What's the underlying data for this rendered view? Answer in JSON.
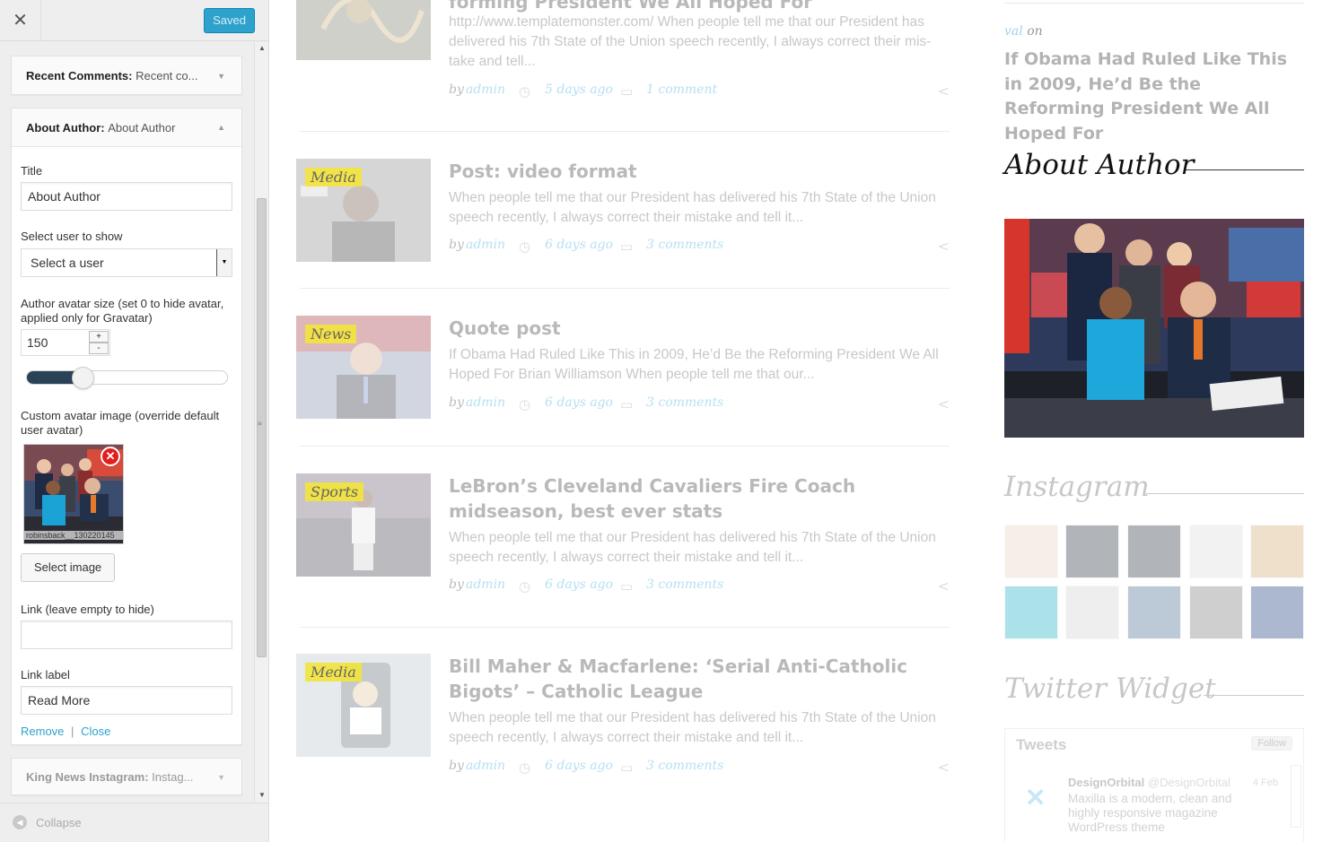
{
  "customizer": {
    "close_icon": "close-icon",
    "saved_label": "Saved",
    "widgets": [
      {
        "name": "Recent Comments:",
        "subtitle": "Recent co..."
      },
      {
        "name": "About Author:",
        "subtitle": "About Author"
      },
      {
        "name": "King News Instagram:",
        "subtitle": "Instag..."
      }
    ],
    "about_author": {
      "title_label": "Title",
      "title_value": "About Author",
      "user_label": "Select user to show",
      "user_selected": "Select a user",
      "avatar_size_label": "Author avatar size (set 0 to hide avatar, applied only for Gravatar)",
      "avatar_size_value": "150",
      "avatar_size_slider_fraction": 0.28,
      "custom_avatar_label": "Custom avatar image (override default user avatar)",
      "avatar_filename": "robinsback__130220145",
      "select_image_label": "Select image",
      "link_label": "Link (leave empty to hide)",
      "link_value": "",
      "link_text_label": "Link label",
      "link_text_value": "Read More",
      "remove_label": "Remove",
      "sep": "|",
      "close_label": "Close"
    },
    "collapse_label": "Collapse",
    "colors": {
      "accent": "#2ea2cc",
      "slider_fill": "#294257",
      "remove_badge": "#e02020"
    }
  },
  "preview": {
    "posts": [
      {
        "title": "forming President We All Hoped For",
        "category": "",
        "excerpt": "http://www.templatemonster.com/ When people tell me that our President has delivered his 7th State of the Union speech recently, I always correct their mis-take and tell...",
        "by": "by",
        "author": "admin",
        "date": "5 days ago",
        "comments": "1 comment"
      },
      {
        "title": "Post: video format",
        "category": "Media",
        "excerpt": "When people tell me that our President has delivered his 7th State of the Union speech recently, I always correct their mistake and tell it...",
        "by": "by",
        "author": "admin",
        "date": "6 days ago",
        "comments": "3 comments"
      },
      {
        "title": "Quote post",
        "category": "News",
        "excerpt": "If Obama Had Ruled Like This in 2009, He’d Be the Reforming President We All Hoped For Brian Williamson When people tell me that our...",
        "by": "by",
        "author": "admin",
        "date": "6 days ago",
        "comments": "3 comments"
      },
      {
        "title": "LeBron’s Cleveland Cavaliers Fire Coach midseason, best ever stats",
        "category": "Sports",
        "excerpt": "When people tell me that our President has delivered his 7th State of the Union speech recently, I always correct their mistake and tell it...",
        "by": "by",
        "author": "admin",
        "date": "6 days ago",
        "comments": "3 comments"
      },
      {
        "title": "Bill Maher & Macfarlene: ‘Serial Anti-Catholic Bigots’ – Catholic League",
        "category": "Media",
        "excerpt": "When people tell me that our President has delivered his 7th State of the Union speech recently, I always correct their mistake and tell it...",
        "by": "by",
        "author": "admin",
        "date": "6 days ago",
        "comments": "3 comments"
      }
    ],
    "sidebar": {
      "recent_comment_author": "val",
      "recent_comment_on": "on",
      "recent_comment_title": "If Obama Had Ruled Like This in 2009, He’d Be the Reforming President We All Hoped For",
      "about_title": "About Author",
      "instagram_title": "Instagram",
      "twitter_title": "Twitter Widget",
      "tweets_label": "Tweets",
      "follow_label": "Follow",
      "tweet_name": "DesignOrbital",
      "tweet_handle": "@DesignOrbital",
      "tweet_date": "4 Feb",
      "tweet_text": "Maxilla is a modern, clean and highly responsive magazine WordPress theme"
    },
    "icons": {
      "clock": "clock-icon",
      "comment": "comment-icon",
      "share": "share-icon"
    }
  }
}
